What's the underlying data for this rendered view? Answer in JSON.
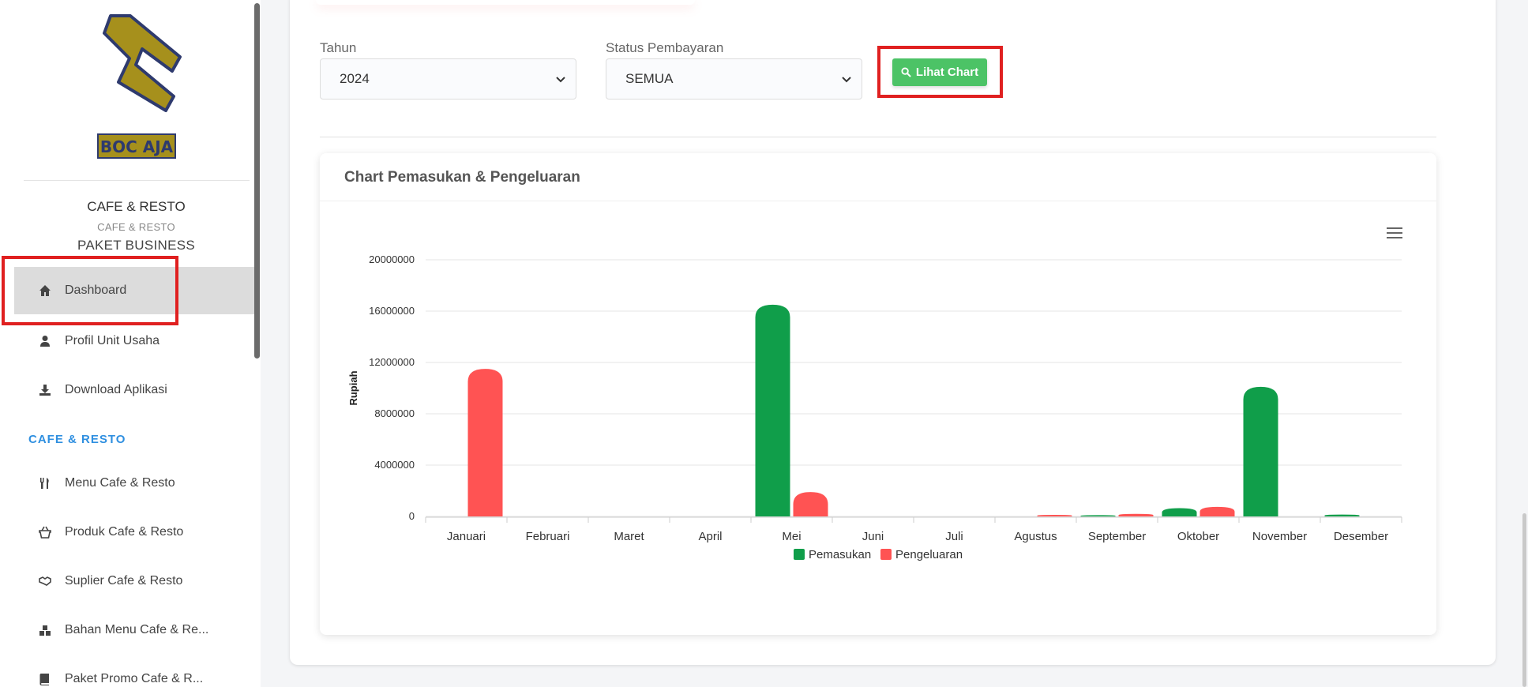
{
  "sidebar": {
    "brand_title": "CAFE & RESTO",
    "brand_subtitle": "CAFE & RESTO",
    "brand_package": "PAKET BUSINESS",
    "logo_text": "BOC AJA",
    "items": [
      {
        "label": "Dashboard",
        "icon": "home-icon",
        "active": true
      },
      {
        "label": "Profil Unit Usaha",
        "icon": "user-icon"
      },
      {
        "label": "Download Aplikasi",
        "icon": "download-icon"
      }
    ],
    "section": "CAFE & RESTO",
    "section_items": [
      {
        "label": "Menu Cafe & Resto",
        "icon": "utensils-icon"
      },
      {
        "label": "Produk Cafe & Resto",
        "icon": "basket-icon"
      },
      {
        "label": "Suplier Cafe & Resto",
        "icon": "handshake-icon"
      },
      {
        "label": "Bahan Menu Cafe & Re...",
        "icon": "cubes-icon"
      },
      {
        "label": "Paket Promo Cafe & R...",
        "icon": "book-icon"
      }
    ]
  },
  "filters": {
    "year_label": "Tahun",
    "year_value": "2024",
    "status_label": "Status Pembayaran",
    "status_value": "SEMUA",
    "button_label": "Lihat Chart"
  },
  "colors": {
    "pemasukan": "#109e4a",
    "pengeluaran": "#ff5353",
    "highlight": "#e02020",
    "button": "#4cc366",
    "section": "#2f8fe0"
  },
  "chart_card": {
    "title": "Chart Pemasukan & Pengeluaran"
  },
  "chart_data": {
    "type": "bar",
    "ylabel": "Rupiah",
    "ylim": [
      0,
      20000000
    ],
    "yticks": [
      "0",
      "4000000",
      "8000000",
      "12000000",
      "16000000",
      "20000000"
    ],
    "categories": [
      "Januari",
      "Februari",
      "Maret",
      "April",
      "Mei",
      "Juni",
      "Juli",
      "Agustus",
      "September",
      "Oktober",
      "November",
      "Desember"
    ],
    "series": [
      {
        "name": "Pemasukan",
        "values": [
          0,
          0,
          0,
          0,
          16500000,
          0,
          0,
          0,
          100000,
          650000,
          10100000,
          150000
        ]
      },
      {
        "name": "Pengeluaran",
        "values": [
          11500000,
          0,
          0,
          0,
          1900000,
          0,
          0,
          120000,
          200000,
          750000,
          0,
          0
        ]
      }
    ],
    "grid": true,
    "legend": "bottom-center"
  }
}
